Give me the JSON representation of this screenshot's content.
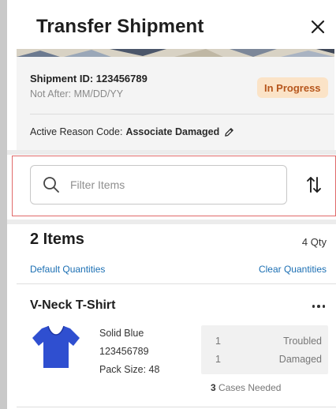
{
  "header": {
    "title": "Transfer Shipment",
    "close_icon": "close-icon"
  },
  "shipment": {
    "id_label": "Shipment ID: 123456789",
    "not_after": "Not After: MM/DD/YY",
    "status": "In Progress",
    "reason_label": "Active Reason Code:",
    "reason_value": "Associate Damaged",
    "edit_icon": "pencil-icon"
  },
  "filter": {
    "placeholder": "Filter Items",
    "search_icon": "search-icon",
    "sort_icon": "sort-arrows-icon"
  },
  "summary": {
    "items_count": "2 Items",
    "qty_total": "4 Qty",
    "default_link": "Default Quantities",
    "clear_link": "Clear Quantities"
  },
  "items": [
    {
      "name": "V-Neck T-Shirt",
      "color": "Solid Blue",
      "sku": "123456789",
      "pack_size": "Pack Size: 48",
      "quantities": [
        {
          "qty": "1",
          "reason": "Troubled"
        },
        {
          "qty": "1",
          "reason": "Damaged"
        }
      ],
      "cases_count": "3",
      "cases_label": "Cases Needed",
      "more_icon": "more-options-icon",
      "image_icon": "tshirt-icon"
    }
  ],
  "colors": {
    "badge_bg": "#fbe3c7",
    "badge_text": "#b6561c",
    "link": "#1b6fb3",
    "shirt": "#2f4fd0",
    "highlight_frame": "#e06a6a"
  }
}
